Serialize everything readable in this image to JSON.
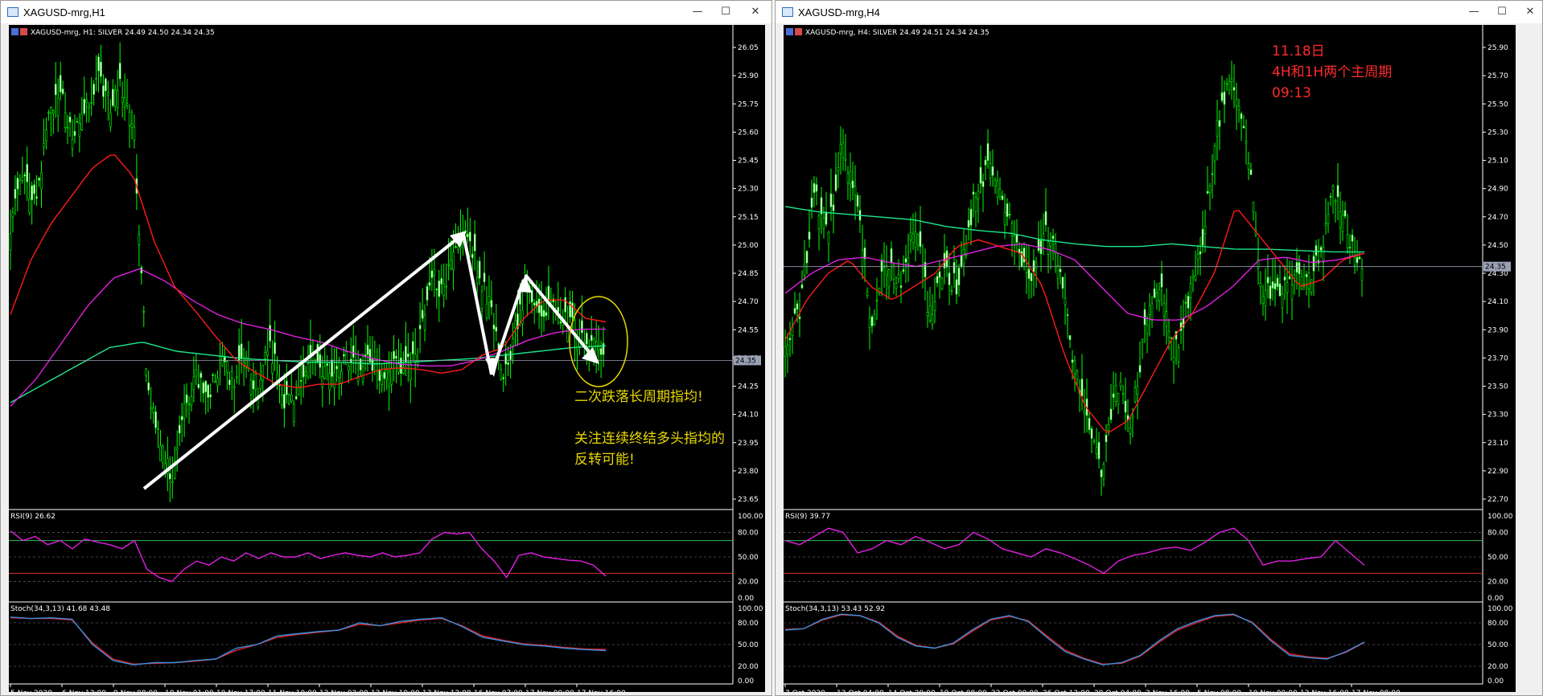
{
  "windows": [
    {
      "title": "XAGUSD-mrg,H1",
      "buttons": {
        "minimize": "—",
        "maximize": "☐",
        "close": "✕"
      },
      "chart_header": "XAGUSD-mrg, H1:  SILVER   24.49  24.50  24.34  24.35",
      "price_axis": [
        "26.05",
        "25.90",
        "25.75",
        "25.60",
        "25.45",
        "25.30",
        "25.15",
        "25.00",
        "24.85",
        "24.70",
        "24.55",
        "24.40",
        "24.25",
        "24.10",
        "23.95",
        "23.80",
        "23.65"
      ],
      "current_price": "24.35",
      "rsi_header": "RSI(9) 26.62",
      "rsi_axis": [
        "100.00",
        "80.00",
        "50.00",
        "20.00",
        "0.00"
      ],
      "stoch_header": "Stoch(34,3,13) 41.68 43.48",
      "stoch_axis": [
        "100.00",
        "80.00",
        "50.00",
        "20.00",
        "0.00"
      ],
      "time_axis": [
        "5 Nov 2020",
        "6 Nov 13:00",
        "9 Nov 08:00",
        "10 Nov 01:00",
        "10 Nov 17:00",
        "11 Nov 10:00",
        "12 Nov 03:00",
        "12 Nov 19:00",
        "13 Nov 12:00",
        "16 Nov 07:00",
        "17 Nov 00:00",
        "17 Nov 16:00"
      ],
      "annotations": [
        "二次跌落长周期指均!",
        "关注连续终结多头指均的",
        "反转可能!"
      ],
      "colors": {
        "annotation": "#e8d800"
      }
    },
    {
      "title": "XAGUSD-mrg,H4",
      "buttons": {
        "minimize": "—",
        "maximize": "☐",
        "close": "✕"
      },
      "chart_header": "XAGUSD-mrg, H4:  SILVER   24.49  24.51  24.34  24.35",
      "price_axis": [
        "25.90",
        "25.70",
        "25.50",
        "25.30",
        "25.10",
        "24.90",
        "24.70",
        "24.50",
        "24.30",
        "24.10",
        "23.90",
        "23.70",
        "23.50",
        "23.30",
        "23.10",
        "22.90",
        "22.70"
      ],
      "current_price": "24.35",
      "rsi_header": "RSI(9) 39.77",
      "rsi_axis": [
        "100.00",
        "80.00",
        "50.00",
        "20.00",
        "0.00"
      ],
      "stoch_header": "Stoch(34,3,13) 53.43 52.92",
      "stoch_axis": [
        "100.00",
        "80.00",
        "50.00",
        "20.00",
        "0.00"
      ],
      "time_axis": [
        "7 Oct 2020",
        "12 Oct 04:00",
        "14 Oct 20:00",
        "19 Oct 08:00",
        "22 Oct 00:00",
        "26 Oct 12:00",
        "29 Oct 04:00",
        "2 Nov 16:00",
        "5 Nov 08:00",
        "10 Nov 00:00",
        "12 Nov 16:00",
        "17 Nov 08:00"
      ],
      "annotations": [
        "11.18日",
        "4H和1H两个主周期",
        "09:13"
      ],
      "colors": {
        "annotation": "#ff2a2a"
      }
    }
  ],
  "chart_data": [
    {
      "type": "candlestick",
      "symbol": "XAGUSD-mrg",
      "timeframe": "H1",
      "ylim": [
        23.55,
        26.1
      ],
      "close_path": [
        25.1,
        25.35,
        25.2,
        25.65,
        25.8,
        25.6,
        25.7,
        25.9,
        25.75,
        25.85,
        25.6,
        24.3,
        23.9,
        23.7,
        24.05,
        24.25,
        24.15,
        24.35,
        24.25,
        24.35,
        24.2,
        24.45,
        24.15,
        24.1,
        24.35,
        24.3,
        24.25,
        24.35,
        24.3,
        24.35,
        24.25,
        24.35,
        24.3,
        24.4,
        24.85,
        24.7,
        24.95,
        25.05,
        24.8,
        24.6,
        24.25,
        24.55,
        24.75,
        24.6,
        24.65,
        24.55,
        24.5,
        24.45,
        24.35
      ],
      "ma_red": [
        24.6,
        24.9,
        25.1,
        25.25,
        25.4,
        25.48,
        25.35,
        25.0,
        24.75,
        24.62,
        24.48,
        24.35,
        24.28,
        24.22,
        24.2,
        24.22,
        24.22,
        24.26,
        24.3,
        24.31,
        24.3,
        24.28,
        24.3,
        24.38,
        24.42,
        24.58,
        24.68,
        24.68,
        24.58,
        24.56
      ],
      "ma_magenta": [
        24.1,
        24.25,
        24.45,
        24.65,
        24.8,
        24.85,
        24.78,
        24.68,
        24.6,
        24.55,
        24.52,
        24.48,
        24.45,
        24.4,
        24.36,
        24.33,
        24.32,
        24.32,
        24.35,
        24.4,
        24.46,
        24.5,
        24.52,
        24.52
      ],
      "ma_green": [
        24.12,
        24.22,
        24.32,
        24.42,
        24.45,
        24.4,
        24.38,
        24.36,
        24.35,
        24.34,
        24.34,
        24.33,
        24.34,
        24.35,
        24.36,
        24.38,
        24.4,
        24.42,
        24.43
      ],
      "rsi": [
        82,
        70,
        75,
        65,
        70,
        60,
        72,
        68,
        65,
        60,
        70,
        35,
        25,
        20,
        35,
        45,
        40,
        50,
        45,
        55,
        48,
        55,
        50,
        50,
        55,
        48,
        52,
        55,
        52,
        50,
        55,
        50,
        52,
        55,
        72,
        80,
        78,
        80,
        60,
        45,
        25,
        52,
        55,
        50,
        48,
        46,
        45,
        40,
        26.62
      ],
      "rsi_levels": [
        70,
        30
      ],
      "stoch_main": [
        88,
        86,
        87,
        85,
        50,
        28,
        22,
        25,
        25,
        28,
        30,
        45,
        50,
        62,
        65,
        68,
        70,
        80,
        76,
        82,
        85,
        87,
        75,
        60,
        55,
        50,
        48,
        45,
        43,
        41.68
      ],
      "stoch_signal": [
        87,
        86,
        86,
        84,
        52,
        30,
        23,
        24,
        25,
        27,
        30,
        42,
        50,
        60,
        64,
        67,
        70,
        78,
        76,
        80,
        84,
        86,
        76,
        62,
        56,
        51,
        49,
        46,
        44,
        43.48
      ]
    },
    {
      "type": "candlestick",
      "symbol": "XAGUSD-mrg",
      "timeframe": "H4",
      "ylim": [
        22.55,
        26.05
      ],
      "close_path": [
        23.8,
        24.0,
        24.9,
        24.6,
        25.3,
        24.8,
        23.9,
        24.4,
        24.2,
        24.7,
        24.0,
        24.3,
        24.2,
        24.8,
        25.1,
        24.9,
        24.5,
        24.2,
        24.6,
        24.4,
        23.6,
        23.2,
        22.8,
        23.5,
        23.2,
        23.9,
        24.2,
        23.7,
        24.1,
        24.6,
        25.4,
        25.8,
        25.3,
        24.2,
        24.1,
        24.3,
        24.2,
        24.4,
        24.9,
        24.6,
        24.35
      ],
      "ma_red": [
        23.8,
        24.1,
        24.3,
        24.4,
        24.2,
        24.1,
        24.2,
        24.3,
        24.5,
        24.55,
        24.5,
        24.45,
        24.2,
        23.7,
        23.3,
        23.1,
        23.2,
        23.5,
        23.8,
        24.0,
        24.3,
        24.8,
        24.6,
        24.4,
        24.2,
        24.25,
        24.4,
        24.45
      ],
      "ma_magenta": [
        24.15,
        24.3,
        24.4,
        24.42,
        24.38,
        24.35,
        24.4,
        24.45,
        24.5,
        24.52,
        24.48,
        24.4,
        24.2,
        24.0,
        23.95,
        23.95,
        24.05,
        24.2,
        24.4,
        24.42,
        24.38,
        24.4,
        24.45
      ],
      "ma_green": [
        24.8,
        24.76,
        24.74,
        24.72,
        24.7,
        24.65,
        24.62,
        24.6,
        24.55,
        24.52,
        24.5,
        24.5,
        24.52,
        24.5,
        24.48,
        24.48,
        24.47,
        24.46,
        24.46
      ],
      "rsi": [
        70,
        65,
        75,
        85,
        80,
        55,
        60,
        70,
        65,
        75,
        68,
        60,
        65,
        80,
        72,
        60,
        55,
        50,
        60,
        55,
        48,
        40,
        30,
        45,
        52,
        55,
        60,
        62,
        58,
        68,
        80,
        85,
        70,
        40,
        45,
        45,
        48,
        50,
        70,
        55,
        39.77
      ],
      "rsi_levels": [
        70,
        30
      ],
      "stoch_main": [
        70,
        72,
        85,
        92,
        90,
        80,
        60,
        48,
        45,
        52,
        70,
        85,
        90,
        82,
        60,
        40,
        30,
        22,
        25,
        35,
        55,
        72,
        82,
        90,
        92,
        80,
        55,
        35,
        32,
        30,
        40,
        53.43
      ],
      "stoch_signal": [
        71,
        72,
        84,
        91,
        90,
        81,
        62,
        49,
        45,
        51,
        68,
        84,
        89,
        83,
        62,
        42,
        31,
        23,
        24,
        34,
        53,
        70,
        80,
        89,
        91,
        81,
        57,
        37,
        33,
        31,
        39,
        52.92
      ]
    }
  ]
}
